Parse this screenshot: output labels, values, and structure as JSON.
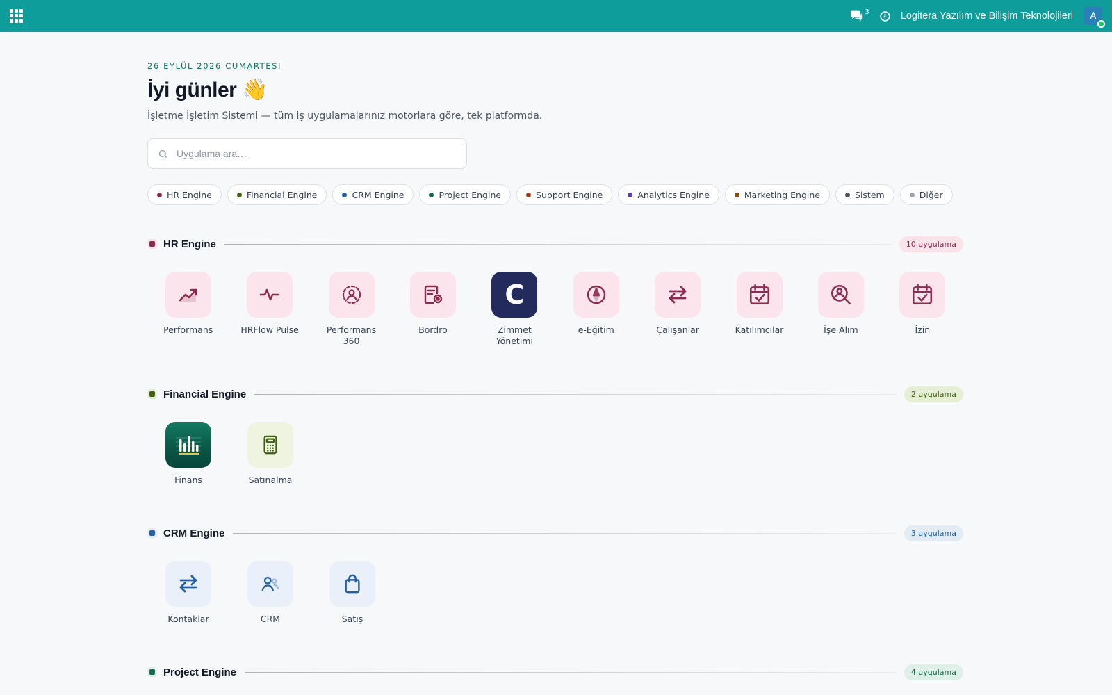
{
  "topbar": {
    "chat_count": "3",
    "company": "Logitera Yazılım ve Bilişim Teknolojileri",
    "avatar_initial": "A"
  },
  "header": {
    "date": "26 EYLÜL 2026 CUMARTESI",
    "greeting": "İyi günler 👋",
    "subtitle": "İşletme İşletim Sistemi — tüm iş uygulamalarınız motorlara göre, tek platformda."
  },
  "search": {
    "placeholder": "Uygulama ara…"
  },
  "filters": [
    {
      "label": "HR Engine",
      "color": "#8b2c4f"
    },
    {
      "label": "Financial Engine",
      "color": "#3f6212"
    },
    {
      "label": "CRM Engine",
      "color": "#1e5fa8"
    },
    {
      "label": "Project Engine",
      "color": "#166a4c"
    },
    {
      "label": "Support Engine",
      "color": "#9a3b17"
    },
    {
      "label": "Analytics Engine",
      "color": "#5b3ea8"
    },
    {
      "label": "Marketing Engine",
      "color": "#8a4a10"
    },
    {
      "label": "Sistem",
      "color": "#4b5563"
    },
    {
      "label": "Diğer",
      "color": "#9ca3af"
    }
  ],
  "sections": [
    {
      "title": "HR Engine",
      "count": "10 uygulama",
      "accent": "#8b2c4f",
      "tile_bg": "#fce4ec",
      "badge_bg": "#fbe3ea",
      "apps": [
        {
          "label": "Performans",
          "icon": "trend-up-icon"
        },
        {
          "label": "HRFlow Pulse",
          "icon": "pulse-icon"
        },
        {
          "label": "Performans 360",
          "icon": "user-circle-icon"
        },
        {
          "label": "Bordro",
          "icon": "payroll-icon"
        },
        {
          "label": "Zimmet Yönetimi",
          "icon": "zimmet-logo-icon",
          "letter": "C"
        },
        {
          "label": "e-Eğitim",
          "icon": "compass-icon"
        },
        {
          "label": "Çalışanlar",
          "icon": "swap-icon"
        },
        {
          "label": "Katılımcılar",
          "icon": "calendar-check-icon"
        },
        {
          "label": "İşe Alım",
          "icon": "user-search-icon"
        },
        {
          "label": "İzin",
          "icon": "calendar-check-icon"
        }
      ]
    },
    {
      "title": "Financial Engine",
      "count": "2 uygulama",
      "accent": "#3f6212",
      "tile_bg": "#eef4df",
      "badge_bg": "#e6efd6",
      "apps": [
        {
          "label": "Finans",
          "icon": "finance-chart-icon"
        },
        {
          "label": "Satınalma",
          "icon": "calculator-icon"
        }
      ]
    },
    {
      "title": "CRM Engine",
      "count": "3 uygulama",
      "accent": "#1e5fa8",
      "tile_bg": "#e9f0f9",
      "badge_bg": "#e3ebf5",
      "apps": [
        {
          "label": "Kontaklar",
          "icon": "swap-icon"
        },
        {
          "label": "CRM",
          "icon": "users-icon"
        },
        {
          "label": "Satış",
          "icon": "shopping-bag-icon"
        }
      ]
    },
    {
      "title": "Project Engine",
      "count": "4 uygulama",
      "accent": "#166a4c",
      "tile_bg": "#e3f2ec",
      "badge_bg": "#dff0e8",
      "apps": []
    }
  ]
}
